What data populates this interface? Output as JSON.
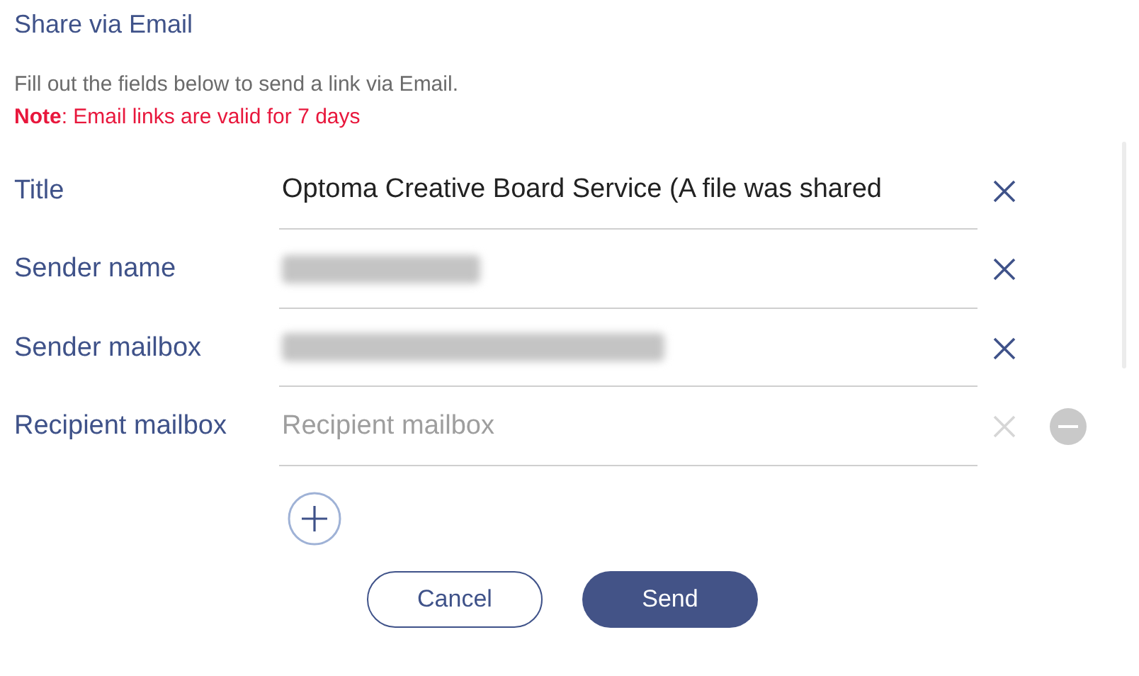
{
  "heading": "Share via Email",
  "description": "Fill out the fields below to send a link via Email.",
  "note": "**Note**: Email links are valid for 7 days",
  "fields": [
    {
      "label": "Title",
      "kind": "text",
      "value": "Optoma Creative Board Service (A file was shared",
      "clear_enabled": true,
      "removable": false
    },
    {
      "label": "Sender name",
      "kind": "redacted",
      "clear_enabled": true,
      "removable": false
    },
    {
      "label": "Sender mailbox",
      "kind": "redacted",
      "clear_enabled": true,
      "removable": false
    },
    {
      "label": "Recipient mailbox",
      "kind": "placeholder",
      "placeholder": "Recipient mailbox",
      "clear_enabled": false,
      "removable": true
    }
  ],
  "buttons": [
    {
      "label": "Cancel",
      "kind": "secondary"
    },
    {
      "label": "Send",
      "kind": "primary"
    }
  ]
}
